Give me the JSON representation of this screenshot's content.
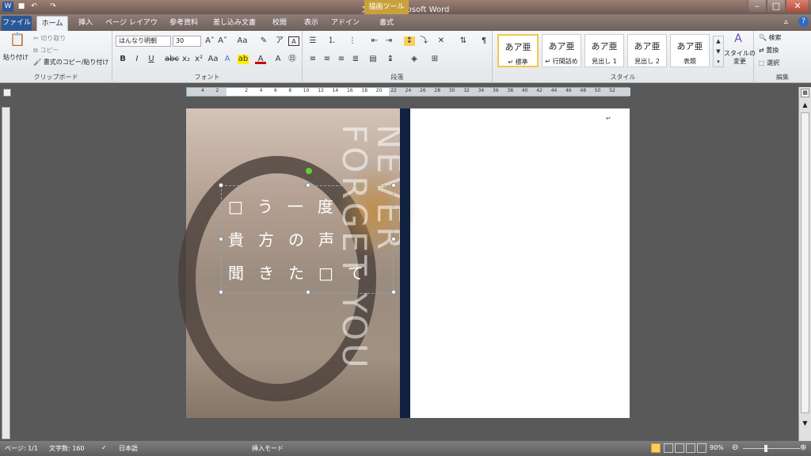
{
  "window": {
    "title": "文書1 - Microsoft Word",
    "context_tab": "描画ツール"
  },
  "tabs": [
    "ファイル",
    "ホーム",
    "挿入",
    "ページ レイアウト",
    "参考資料",
    "差し込み文書",
    "校閲",
    "表示",
    "アドイン",
    "書式"
  ],
  "clipboard": {
    "paste": "貼り付け",
    "cut": "切り取り",
    "copy": "コピー",
    "format_painter": "書式のコピー/貼り付け",
    "label": "クリップボード"
  },
  "font": {
    "name": "はんなり明朝",
    "size": "30",
    "label": "フォント"
  },
  "paragraph": {
    "label": "段落"
  },
  "styles": {
    "label": "スタイル",
    "items": [
      {
        "preview": "あア亜",
        "name": "↵ 標準"
      },
      {
        "preview": "あア亜",
        "name": "↵ 行間詰め"
      },
      {
        "preview": "あア亜",
        "name": "見出し 1"
      },
      {
        "preview": "あア亜",
        "name": "見出し 2"
      },
      {
        "preview": "あア亜",
        "name": "表題"
      }
    ],
    "change": "スタイルの\n変更"
  },
  "editing": {
    "label": "編集",
    "search": "検索",
    "replace": "置換",
    "select": "選択"
  },
  "document": {
    "vertical_text": "NEVER FORGET YOU",
    "line1": "□う一度",
    "line2": "貴方の声",
    "line3": "聞きた□て"
  },
  "status": {
    "page": "ページ: 1/1",
    "words": "文字数: 160",
    "lang": "日本語",
    "mode": "挿入モード",
    "zoom": "90%"
  },
  "ruler_numbers": [
    "4",
    "2",
    "",
    "2",
    "4",
    "6",
    "8",
    "10",
    "12",
    "14",
    "16",
    "18",
    "20",
    "22",
    "24",
    "26",
    "28",
    "30",
    "32",
    "34",
    "36",
    "38",
    "40",
    "42",
    "44",
    "46",
    "48",
    "50",
    "52"
  ]
}
